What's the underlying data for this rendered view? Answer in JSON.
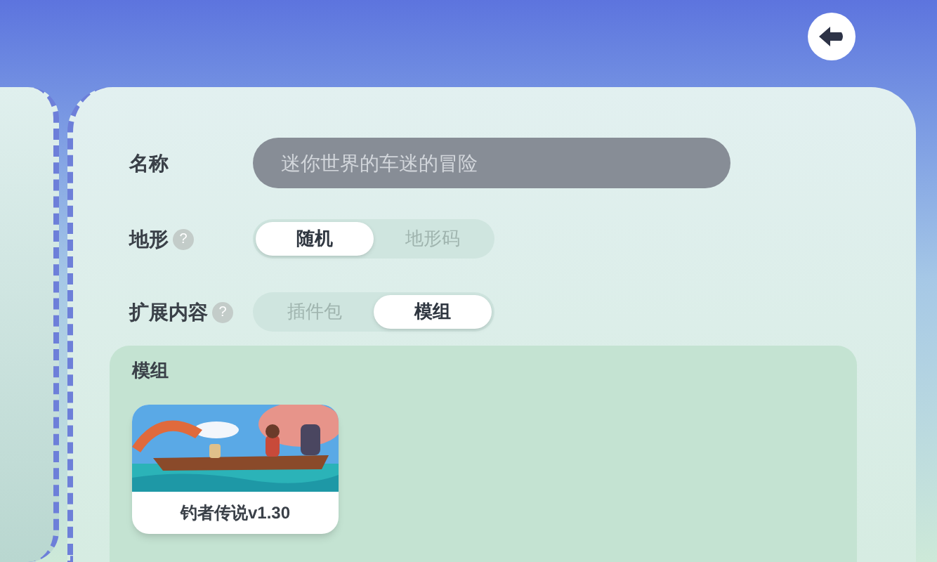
{
  "form": {
    "name": {
      "label": "名称",
      "placeholder": "迷你世界的车迷的冒险"
    },
    "terrain": {
      "label": "地形",
      "help": "?",
      "options": [
        {
          "label": "随机",
          "selected": true
        },
        {
          "label": "地形码",
          "selected": false
        }
      ]
    },
    "extension": {
      "label": "扩展内容",
      "help": "?",
      "options": [
        {
          "label": "插件包",
          "selected": false
        },
        {
          "label": "模组",
          "selected": true
        }
      ]
    }
  },
  "mods": {
    "title": "模组",
    "items": [
      {
        "title": "钓者传说v1.30",
        "kind": "picture"
      }
    ]
  }
}
